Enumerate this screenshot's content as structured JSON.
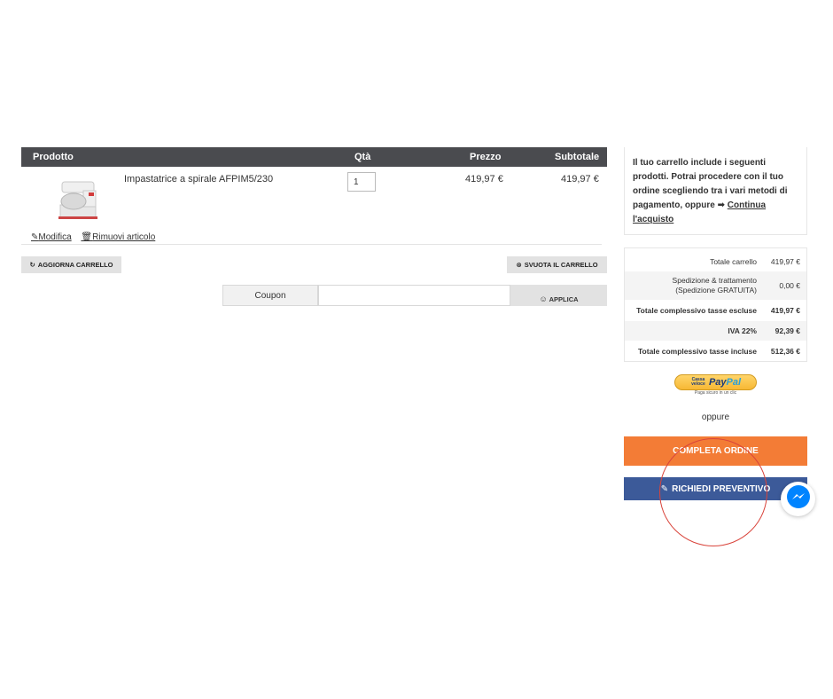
{
  "cart": {
    "headers": {
      "product": "Prodotto",
      "qty": "Qtà",
      "price": "Prezzo",
      "subtotal": "Subtotale"
    },
    "items": [
      {
        "name": "Impastatrice a spirale AFPIM5/230",
        "qty": "1",
        "price": "419,97 €",
        "subtotal": "419,97 €"
      }
    ],
    "edit_label": "Modifica",
    "remove_label": "Rimuovi articolo",
    "update_button": "AGGIORNA CARRELLO",
    "empty_button": "SVUOTA IL CARRELLO",
    "coupon_label": "Coupon",
    "coupon_value": "",
    "apply_button": "APPLICA"
  },
  "sidebar": {
    "info_text": "Il tuo carrello include i seguenti prodotti. Potrai procedere con il tuo ordine scegliendo tra i vari metodi di pagamento, oppure",
    "info_link": "Continua l'acquisto",
    "totals": [
      {
        "label": "Totale carrello",
        "value": "419,97 €"
      },
      {
        "label": "Spedizione & trattamento",
        "label2": "(Spedizione GRATUITA)",
        "value": "0,00 €"
      },
      {
        "label": "Totale complessivo tasse escluse",
        "value": "419,97 €"
      },
      {
        "label": "IVA 22%",
        "value": "92,39 €"
      },
      {
        "label": "Totale complessivo tasse incluse",
        "value": "512,36 €"
      }
    ],
    "paypal_small": "Cassa veloce",
    "paypal_brand_1": "Pay",
    "paypal_brand_2": "Pal",
    "paypal_sub": "Paga sicuro in un clic",
    "or_text": "oppure",
    "complete_button": "COMPLETA ORDINE",
    "quote_button": "RICHIEDI PREVENTIVO"
  },
  "colors": {
    "header_bg": "#4a4b4f",
    "complete_bg": "#f37c36",
    "quote_bg": "#3c5a99",
    "annotation_circle": "#d9443b",
    "messenger": "#0084ff"
  }
}
